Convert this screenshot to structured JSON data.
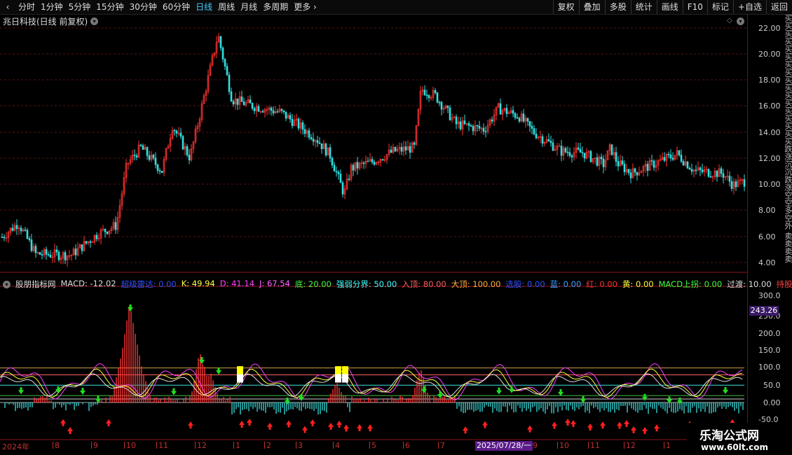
{
  "topbar": {
    "tabs": [
      "分时",
      "1分钟",
      "5分钟",
      "15分钟",
      "30分钟",
      "60分钟",
      "日线",
      "周线",
      "月线",
      "多周期",
      "更多"
    ],
    "active_tab": "日线",
    "right_buttons": [
      "复权",
      "叠加",
      "多股",
      "统计",
      "画线",
      "F10",
      "标记",
      "+自选",
      "返回"
    ]
  },
  "title": "兆日科技(日线 前复权)",
  "price_axis": [
    "22.00",
    "20.00",
    "18.00",
    "16.00",
    "14.00",
    "12.00",
    "10.00",
    "8.00",
    "6.00",
    "4.00"
  ],
  "indicator_axis": [
    "300.0",
    "250.0",
    "200.0",
    "150.0",
    "100.0",
    "50.0",
    "0.00",
    "-50.0"
  ],
  "price_box": "243.26",
  "legend": [
    {
      "label": "股朋指标网",
      "color": "#dddddd"
    },
    {
      "label": "MACD: -12.02",
      "color": "#dddddd"
    },
    {
      "label": "超级雷达: 0.00",
      "color": "#3050ff"
    },
    {
      "label": "K: 49.94",
      "color": "#ffff40"
    },
    {
      "label": "D: 41.14",
      "color": "#ff40ff"
    },
    {
      "label": "J: 67.54",
      "color": "#ff60ff"
    },
    {
      "label": "底: 20.00",
      "color": "#40ff40"
    },
    {
      "label": "强弱分界: 50.00",
      "color": "#40ffff"
    },
    {
      "label": "入顶: 80.00",
      "color": "#ff6060"
    },
    {
      "label": "大顶: 100.00",
      "color": "#ffb040"
    },
    {
      "label": "选股: 0.00",
      "color": "#3050ff"
    },
    {
      "label": "蓝: 0.00",
      "color": "#40a0ff"
    },
    {
      "label": "红: 0.00",
      "color": "#ff3030"
    },
    {
      "label": "黄: 0.00",
      "color": "#ffff40"
    },
    {
      "label": "MACD上拐: 0.00",
      "color": "#40ff40"
    },
    {
      "label": "过渡: 10.00",
      "color": "#dddddd"
    },
    {
      "label": "持股:",
      "color": "#ff4040"
    }
  ],
  "xaxis": [
    "2024年",
    "8",
    "9",
    "10",
    "11",
    "12",
    "1",
    "2",
    "3",
    "4",
    "5",
    "6",
    "7",
    "9",
    "10",
    "11",
    "12",
    "1"
  ],
  "date_box": "2025/07/28/一",
  "right_strip": "买买买买买买买买买买买买买买买买买跌涨沉沉跌涨空空多空外 卖卖卖卖",
  "watermark": {
    "line1": "乐淘公式网",
    "line2": "www.60lt.com"
  },
  "icons": {
    "back": "chevron-left-icon",
    "more": "chevron-right-icon"
  }
}
